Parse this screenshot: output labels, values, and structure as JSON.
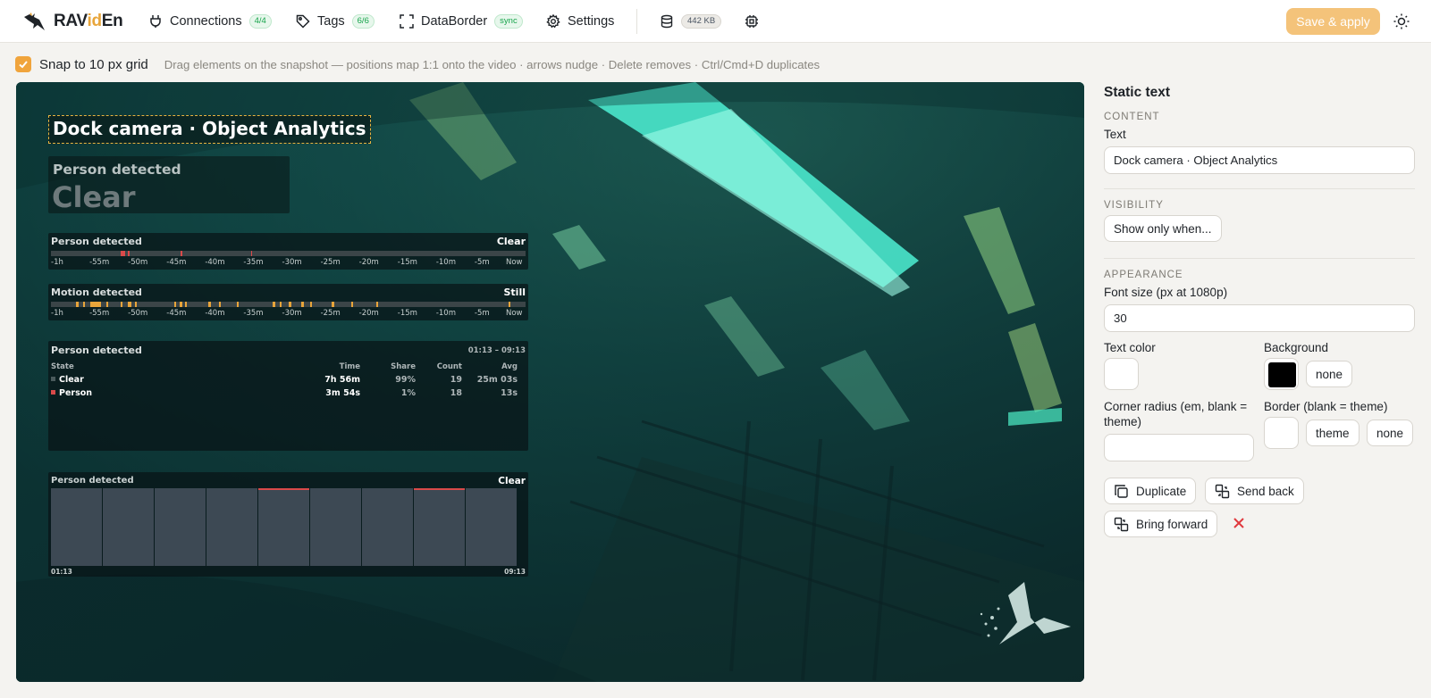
{
  "app": {
    "name_prefix": "RAV",
    "name_accent": "id",
    "name_suffix": "En",
    "accent_color": "#e8a53a"
  },
  "nav": {
    "connections": {
      "label": "Connections",
      "badge": "4/4",
      "icon": "plug-icon"
    },
    "tags": {
      "label": "Tags",
      "badge": "6/6",
      "icon": "tag-icon"
    },
    "databorder": {
      "label": "DataBorder",
      "badge": "sync",
      "icon": "frame-corners-icon"
    },
    "settings": {
      "label": "Settings",
      "icon": "gear-icon"
    },
    "storage": {
      "badge": "442 KB",
      "icon": "database-icon"
    },
    "chip": {
      "icon": "chip-icon"
    }
  },
  "toolbar": {
    "save_label": "Save & apply",
    "save_color": "#f4c37a",
    "theme_icon": "sun-icon"
  },
  "snap": {
    "checked": true,
    "label": "Snap to 10 px grid",
    "hint": "Drag elements on the snapshot — positions map 1:1 onto the video · arrows nudge · Delete removes · Ctrl/Cmd+D duplicates"
  },
  "overlay": {
    "title": "Dock camera · Object Analytics",
    "big_state": {
      "label": "Person detected",
      "value": "Clear"
    },
    "timeline_person": {
      "title": "Person detected",
      "state": "Clear",
      "ticks": [
        "-1h",
        "-55m",
        "-50m",
        "-45m",
        "-40m",
        "-35m",
        "-30m",
        "-25m",
        "-20m",
        "-15m",
        "-10m",
        "-5m",
        "Now"
      ]
    },
    "timeline_motion": {
      "title": "Motion detected",
      "state": "Still",
      "ticks": [
        "-1h",
        "-55m",
        "-50m",
        "-45m",
        "-40m",
        "-35m",
        "-30m",
        "-25m",
        "-20m",
        "-15m",
        "-10m",
        "-5m",
        "Now"
      ]
    },
    "stats": {
      "title": "Person detected",
      "range": "01:13 – 09:13",
      "headers": [
        "State",
        "Time",
        "Share",
        "Count",
        "Avg"
      ],
      "rows": [
        {
          "state": "Clear",
          "time": "7h 56m",
          "share": "99%",
          "count": "19",
          "avg": "25m 03s",
          "color": "#4a5a5c"
        },
        {
          "state": "Person",
          "time": "3m 54s",
          "share": "1%",
          "count": "18",
          "avg": "13s",
          "color": "#d94a4a"
        }
      ]
    },
    "bars": {
      "title": "Person detected",
      "state": "Clear",
      "start": "01:13",
      "end": "09:13",
      "hot_bars": [
        4,
        7
      ]
    }
  },
  "panel": {
    "title": "Static text",
    "content_section": "CONTENT",
    "text_label": "Text",
    "text_value": "Dock camera · Object Analytics",
    "visibility_section": "VISIBILITY",
    "visibility_button": "Show only when...",
    "appearance_section": "APPEARANCE",
    "font_size_label": "Font size (px at 1080p)",
    "font_size_value": "30",
    "text_color_label": "Text color",
    "background_label": "Background",
    "background_none": "none",
    "radius_label": "Corner radius (em, blank = theme)",
    "radius_value": "",
    "border_label": "Border (blank = theme)",
    "border_theme": "theme",
    "border_none": "none",
    "duplicate": "Duplicate",
    "send_back": "Send back",
    "bring_forward": "Bring forward"
  }
}
